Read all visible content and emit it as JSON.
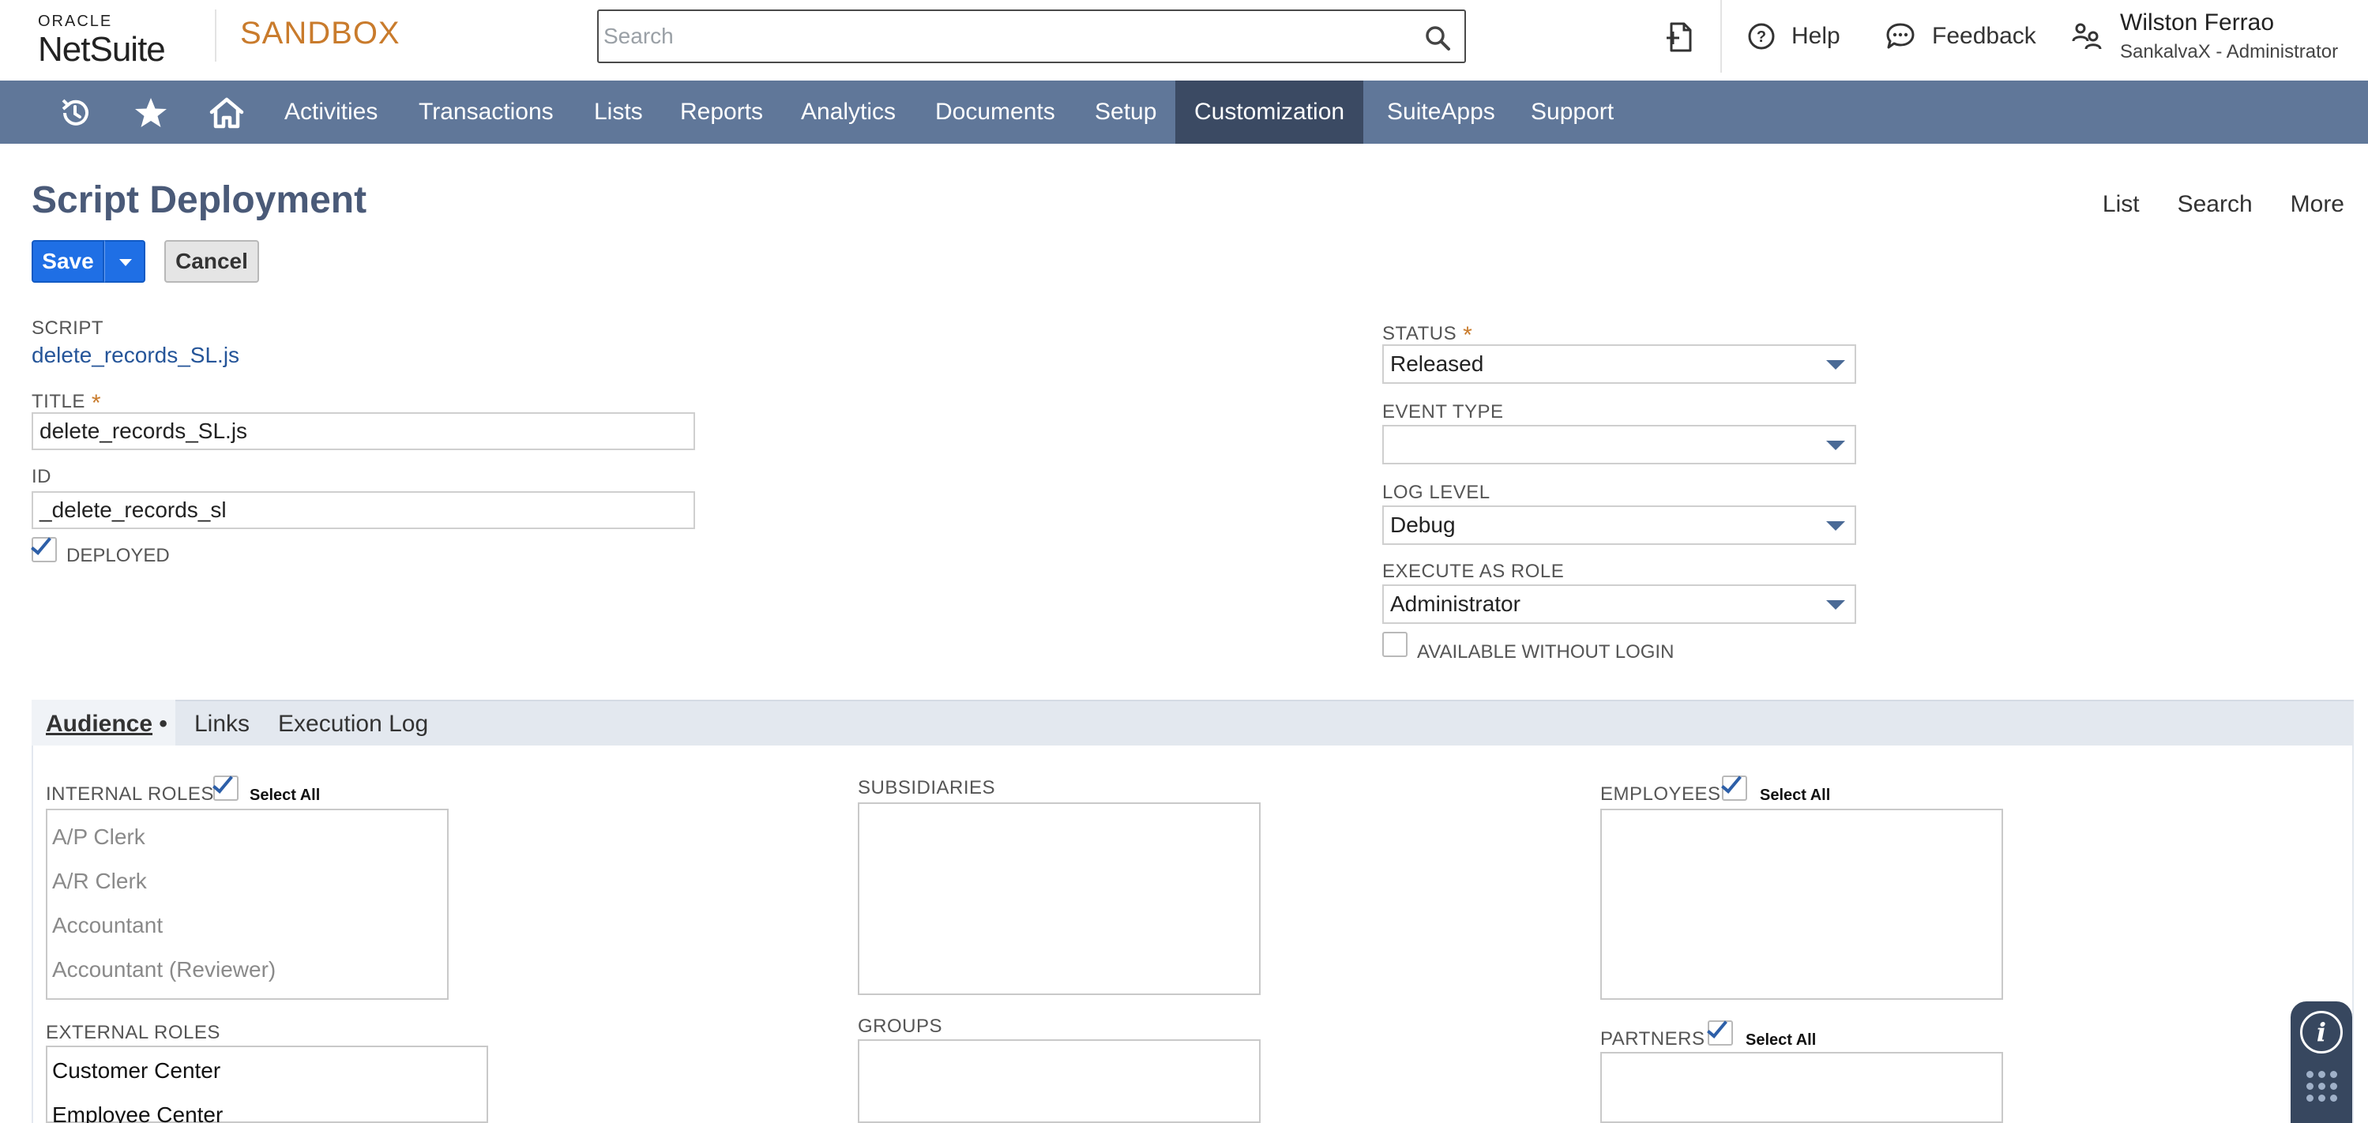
{
  "header": {
    "logo_oracle": "ORACLE",
    "logo_netsuite": "NetSuite",
    "environment": "SANDBOX",
    "search_placeholder": "Search",
    "help_label": "Help",
    "feedback_label": "Feedback",
    "user_name": "Wilston Ferrao",
    "user_role": "SankalvaX - Administrator"
  },
  "nav": {
    "items": [
      {
        "label": "Activities"
      },
      {
        "label": "Transactions"
      },
      {
        "label": "Lists"
      },
      {
        "label": "Reports"
      },
      {
        "label": "Analytics"
      },
      {
        "label": "Documents"
      },
      {
        "label": "Setup"
      },
      {
        "label": "Customization",
        "active": true
      },
      {
        "label": "SuiteApps"
      },
      {
        "label": "Support"
      }
    ]
  },
  "page": {
    "title": "Script Deployment",
    "links": [
      "List",
      "Search",
      "More"
    ]
  },
  "buttons": {
    "save": "Save",
    "cancel": "Cancel"
  },
  "form": {
    "script_label": "SCRIPT",
    "script_value": "delete_records_SL.js",
    "title_label": "TITLE",
    "title_value": "delete_records_SL.js",
    "id_label": "ID",
    "id_value": "_delete_records_sl",
    "deployed_label": "DEPLOYED",
    "deployed_checked": true,
    "status_label": "STATUS",
    "status_value": "Released",
    "event_type_label": "EVENT TYPE",
    "event_type_value": "",
    "log_level_label": "LOG LEVEL",
    "log_level_value": "Debug",
    "execute_as_role_label": "EXECUTE AS ROLE",
    "execute_as_role_value": "Administrator",
    "available_without_login_label": "AVAILABLE WITHOUT LOGIN",
    "available_without_login_checked": false
  },
  "tabs": [
    {
      "label": "Audience",
      "active": true,
      "marker": "•"
    },
    {
      "label": "Links"
    },
    {
      "label": "Execution Log"
    }
  ],
  "audience": {
    "select_all_label": "Select All",
    "internal_roles_label": "INTERNAL ROLES",
    "internal_roles_select_all": true,
    "internal_roles": [
      "A/P Clerk",
      "A/R Clerk",
      "Accountant",
      "Accountant (Reviewer)"
    ],
    "subsidiaries_label": "SUBSIDIARIES",
    "employees_label": "EMPLOYEES",
    "employees_select_all": true,
    "external_roles_label": "EXTERNAL ROLES",
    "external_roles": [
      "Customer Center",
      "Employee Center"
    ],
    "groups_label": "GROUPS",
    "partners_label": "PARTNERS",
    "partners_select_all": true
  },
  "colors": {
    "nav_bg": "#607799",
    "nav_active": "#3b4a63",
    "primary_button": "#1f6fe5",
    "sandbox_accent": "#c97b2c",
    "title_color": "#4a5a78",
    "link_color": "#255599"
  },
  "icons": {
    "recent": "history-icon",
    "favorites": "star-icon",
    "home": "home-icon",
    "search": "search-icon",
    "notifications": "document-bell-icon",
    "help": "question-circle-icon",
    "feedback": "chat-bubble-icon",
    "roles": "switch-role-icon",
    "info": "info-icon"
  }
}
